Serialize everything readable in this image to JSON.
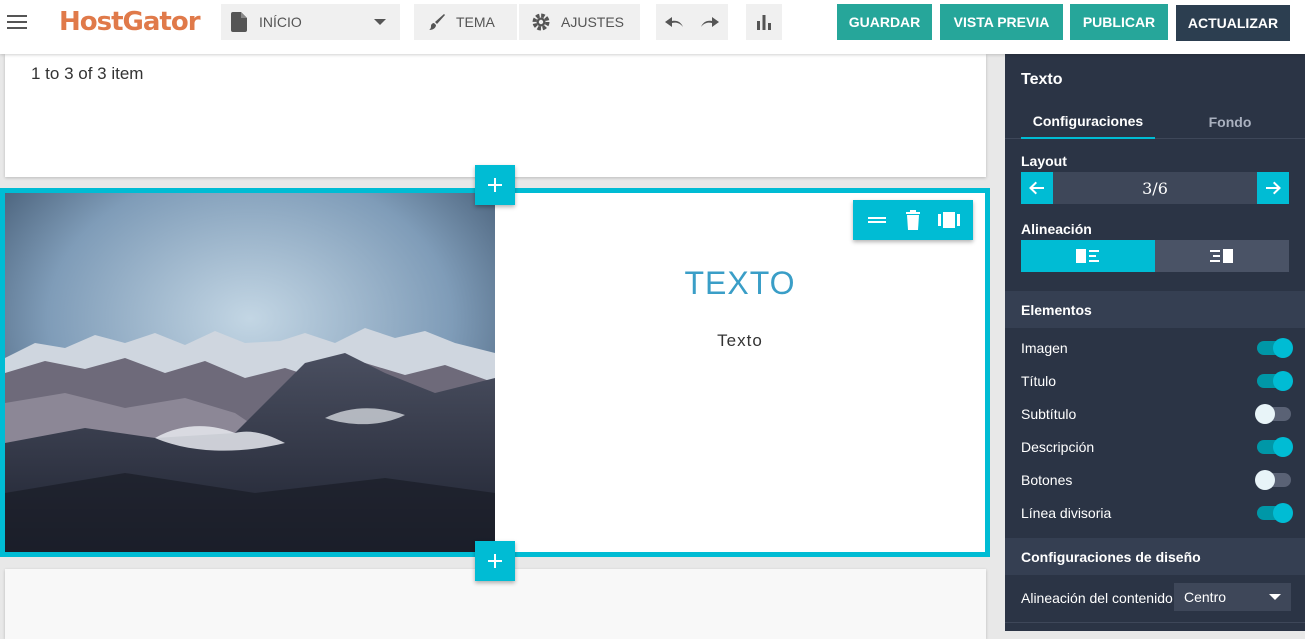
{
  "topbar": {
    "logo": "HostGator",
    "page_select": "INÍCIO",
    "tema": "TEMA",
    "ajustes": "AJUSTES",
    "guardar": "GUARDAR",
    "vista_previa": "VISTA PREVIA",
    "publicar": "PUBLICAR",
    "actualizar": "ACTUALIZAR"
  },
  "canvas": {
    "items_count": "1 to 3 of 3 item",
    "section_title": "TEXTO",
    "section_body": "Texto"
  },
  "panel": {
    "title": "Texto",
    "tabs": [
      "Configuraciones",
      "Fondo"
    ],
    "layout_label": "Layout",
    "layout_value": "3/6",
    "alignment_label": "Alineación",
    "elements_header": "Elementos",
    "elements": [
      {
        "label": "Imagen",
        "on": true
      },
      {
        "label": "Título",
        "on": true
      },
      {
        "label": "Subtítulo",
        "on": false
      },
      {
        "label": "Descripción",
        "on": true
      },
      {
        "label": "Botones",
        "on": false
      },
      {
        "label": "Línea divisoria",
        "on": true
      }
    ],
    "design_header": "Configuraciones de diseño",
    "content_align_label": "Alineación del contenido",
    "content_align_value": "Centro"
  },
  "colors": {
    "accent": "#00bcd4",
    "green": "#26a69a",
    "dark": "#2c3e50",
    "panel_bg": "#2b3445",
    "logo": "#e07a4a"
  }
}
